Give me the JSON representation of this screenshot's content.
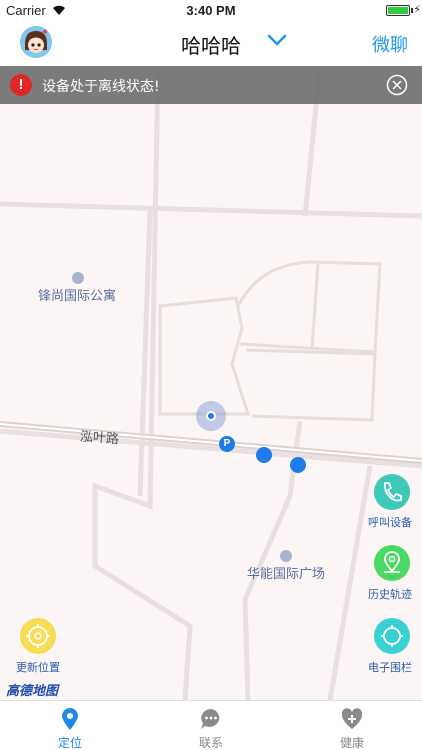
{
  "status_bar": {
    "carrier": "Carrier",
    "time": "3:40 PM"
  },
  "nav": {
    "title": "哈哈哈",
    "chat_label": "微聊"
  },
  "alert": {
    "message": "设备处于离线状态!"
  },
  "map": {
    "pois": [
      {
        "label": "锋尚国际公寓"
      },
      {
        "label": "华能国际广场"
      }
    ],
    "road_label": "泓叶路",
    "provider_logo": "高德地图",
    "parking_glyph": "P"
  },
  "actions": {
    "call": "呼叫设备",
    "history": "历史轨迹",
    "fence": "电子围栏",
    "refresh": "更新位置"
  },
  "tabs": [
    {
      "label": "定位",
      "active": true
    },
    {
      "label": "联系",
      "active": false
    },
    {
      "label": "健康",
      "active": false
    }
  ],
  "colors": {
    "accent": "#2196e8",
    "alert_bg": "#6e6e6e",
    "warn_red": "#e02727",
    "call_teal": "#3cc9b8",
    "history_green": "#4cd865",
    "fence_cyan": "#38d0d3",
    "refresh_yellow": "#f7dc55"
  }
}
